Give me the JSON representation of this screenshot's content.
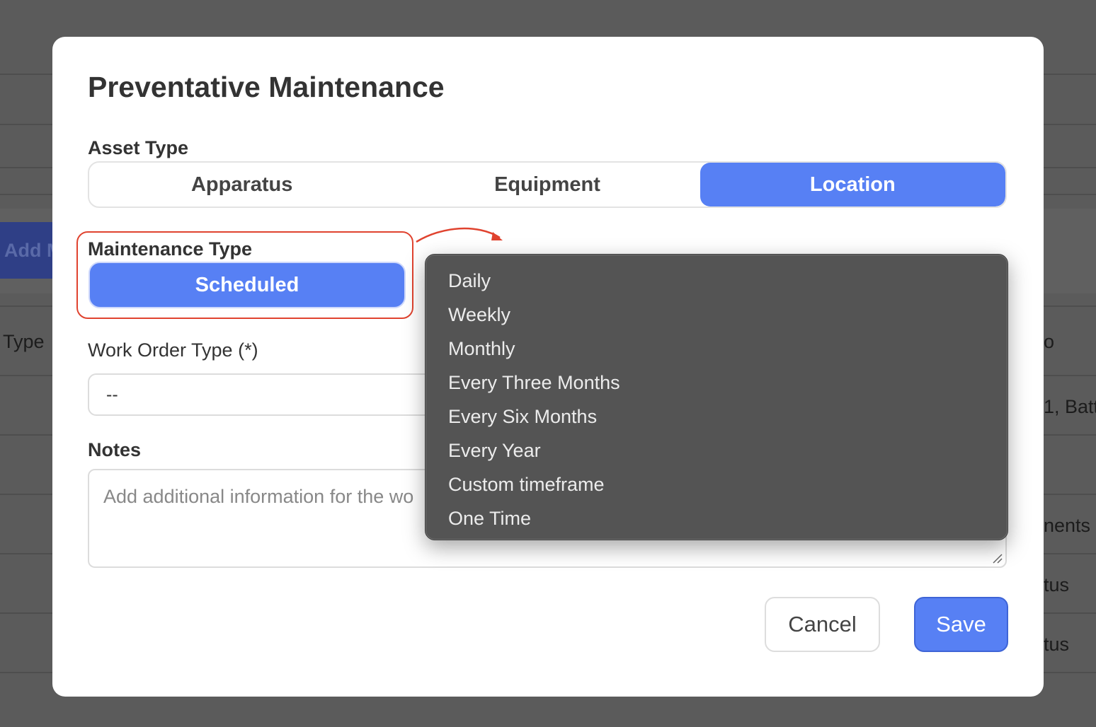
{
  "background": {
    "add_button_label": "Add M",
    "col_type": "Type",
    "col_right_fragment": "o",
    "row1_fragment": "1, Batt",
    "row2_fragment": "nents",
    "row3_fragment": "tus",
    "row4_fragment": "tus"
  },
  "modal": {
    "title": "Preventative Maintenance",
    "asset_type": {
      "label": "Asset Type",
      "options": [
        "Apparatus",
        "Equipment",
        "Location"
      ],
      "selected": "Location"
    },
    "maintenance_type": {
      "label": "Maintenance Type",
      "button_label": "Scheduled"
    },
    "work_order_type": {
      "label": "Work Order Type (*)",
      "value": "--"
    },
    "notes": {
      "label": "Notes",
      "placeholder": "Add additional information for the wo"
    },
    "cancel_label": "Cancel",
    "save_label": "Save"
  },
  "frequency_dropdown": {
    "options": [
      "Daily",
      "Weekly",
      "Monthly",
      "Every Three Months",
      "Every Six Months",
      "Every Year",
      "Custom timeframe",
      "One Time"
    ]
  },
  "colors": {
    "accent": "#5780f4",
    "annotation": "#e0432f",
    "overlay": "#5b5b5b",
    "dropdown_bg": "#545454"
  }
}
